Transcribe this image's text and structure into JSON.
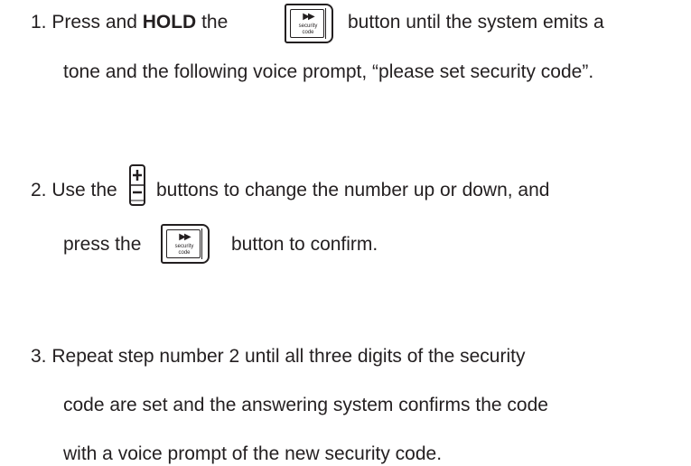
{
  "step1": {
    "part_a": "1. Press and ",
    "bold": "HOLD",
    "part_b": " the",
    "part_c": "button until the system emits a",
    "line2": "tone and the following voice prompt, “please set security code”."
  },
  "step2": {
    "part_a": "2. Use the",
    "part_b": "buttons to change the number up or down, and",
    "line2_a": "press the",
    "line2_b": "button to confirm."
  },
  "step3": {
    "line1": "3. Repeat step number 2 until all three digits of the security",
    "line2": "code are set and the answering system confirms the code",
    "line3": "with a voice prompt of the new security code."
  },
  "icons": {
    "security_code_button": {
      "name": "security-code-button-icon",
      "glyph": "▶▶",
      "caption_line1": "security",
      "caption_line2": "code"
    },
    "plus_minus_button": {
      "name": "plus-minus-button-icon"
    }
  }
}
